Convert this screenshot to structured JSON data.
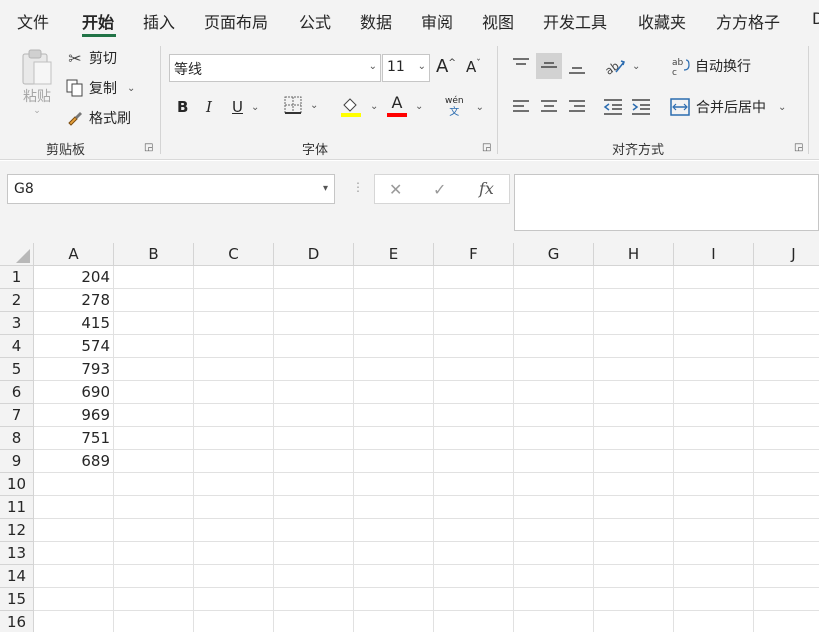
{
  "menu": {
    "items": [
      "文件",
      "开始",
      "插入",
      "页面布局",
      "公式",
      "数据",
      "审阅",
      "视图",
      "开发工具",
      "收藏夹",
      "方方格子",
      "D"
    ],
    "active": "开始",
    "accent_color": "#217346"
  },
  "ribbon": {
    "clipboard": {
      "paste_label": "粘贴",
      "cut_label": "剪切",
      "copy_label": "复制",
      "format_painter_label": "格式刷",
      "group_label": "剪贴板"
    },
    "font": {
      "font_name": "等线",
      "font_size": "11",
      "bold": "B",
      "italic": "I",
      "underline": "U",
      "font_color_glyph": "A",
      "phonetic_top": "wén",
      "phonetic_bottom": "文",
      "group_label": "字体",
      "highlight_color": "#ffff00",
      "font_color": "#ff0000"
    },
    "alignment": {
      "wrap_text_label": "自动换行",
      "merge_center_label": "合并后居中",
      "group_label": "对齐方式"
    }
  },
  "formula_bar": {
    "name_box": "G8",
    "cancel_glyph": "✕",
    "enter_glyph": "✓",
    "fx_label": "fx",
    "content": ""
  },
  "sheet": {
    "columns": [
      "A",
      "B",
      "C",
      "D",
      "E",
      "F",
      "G",
      "H",
      "I",
      "J"
    ],
    "rows": [
      "1",
      "2",
      "3",
      "4",
      "5",
      "6",
      "7",
      "8",
      "9",
      "10",
      "11",
      "12",
      "13",
      "14",
      "15",
      "16"
    ],
    "column_a_values": [
      "204",
      "278",
      "415",
      "574",
      "793",
      "690",
      "969",
      "751",
      "689"
    ]
  }
}
